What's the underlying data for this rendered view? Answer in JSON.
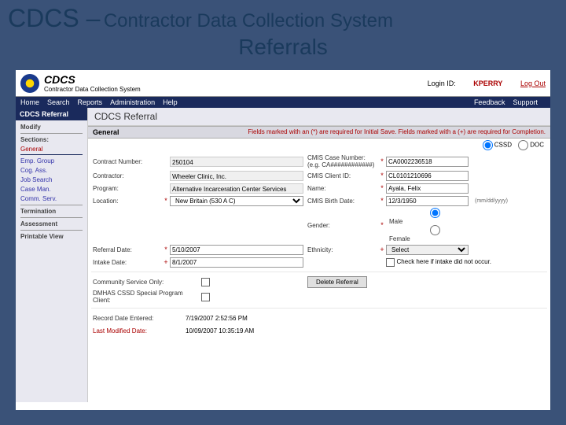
{
  "slide": {
    "t1": "CDCS –",
    "t2": "Contractor Data Collection System",
    "sub": "Referrals"
  },
  "hdr": {
    "brand1": "CDCS",
    "brand2": "Contractor Data Collection System",
    "login_label": "Login ID:",
    "user": "KPERRY",
    "logout": "Log Out"
  },
  "menu": {
    "home": "Home",
    "search": "Search",
    "reports": "Reports",
    "admin": "Administration",
    "help": "Help",
    "feedback": "Feedback",
    "support": "Support"
  },
  "side": {
    "tab": "CDCS Referral",
    "modify": "Modify",
    "sections": "Sections:",
    "items": [
      "General",
      "Emp. Group",
      "Cog. Ass.",
      "Job Search",
      "Case Man.",
      "Comm. Serv."
    ],
    "term": "Termination",
    "assess": "Assessment",
    "print": "Printable View"
  },
  "panel": "CDCS Referral",
  "sect": {
    "general": "General",
    "req": "Fields marked with an (*) are required for Initial Save. Fields marked with a (+) are required for Completion."
  },
  "topr": {
    "cssd": "CSSD",
    "doc": "DOC"
  },
  "f": {
    "contract_num": "Contract Number:",
    "contract_num_v": "250104",
    "cmis_case": "CMIS Case Number: (e.g. CA############)",
    "cmis_case_v": "CA0002236518",
    "contractor": "Contractor:",
    "contractor_v": "Wheeler Clinic, Inc.",
    "cmis_client": "CMIS Client ID:",
    "cmis_client_v": "CL0101210696",
    "program": "Program:",
    "program_v": "Alternative Incarceration Center Services",
    "cmis_birth": "CMIS Birth Date:",
    "cmis_birth_v": "12/3/1950",
    "mmdd": "(mm/dd/yyyy)",
    "location": "Location:",
    "location_v": "New Britain (530 A C)",
    "gender": "Gender:",
    "male": "Male",
    "female": "Female",
    "name": "Name:",
    "name_v": "Ayala, Felix",
    "referral": "Referral Date:",
    "referral_v": "5/10/2007",
    "ethnicity": "Ethnicity:",
    "ethnicity_v": "Select",
    "intake": "Intake Date:",
    "intake_v": "8/1/2007",
    "intake_chk": "Check here if intake did not occur.",
    "comm": "Community Service Only:",
    "dmhas": "DMHAS CSSD Special Program Client:",
    "delete_btn": "Delete Referral",
    "rec_entered": "Record Date Entered:",
    "rec_entered_v": "7/19/2007 2:52:56 PM",
    "last_mod": "Last Modified Date:",
    "last_mod_v": "10/09/2007 10:35:19 AM"
  }
}
